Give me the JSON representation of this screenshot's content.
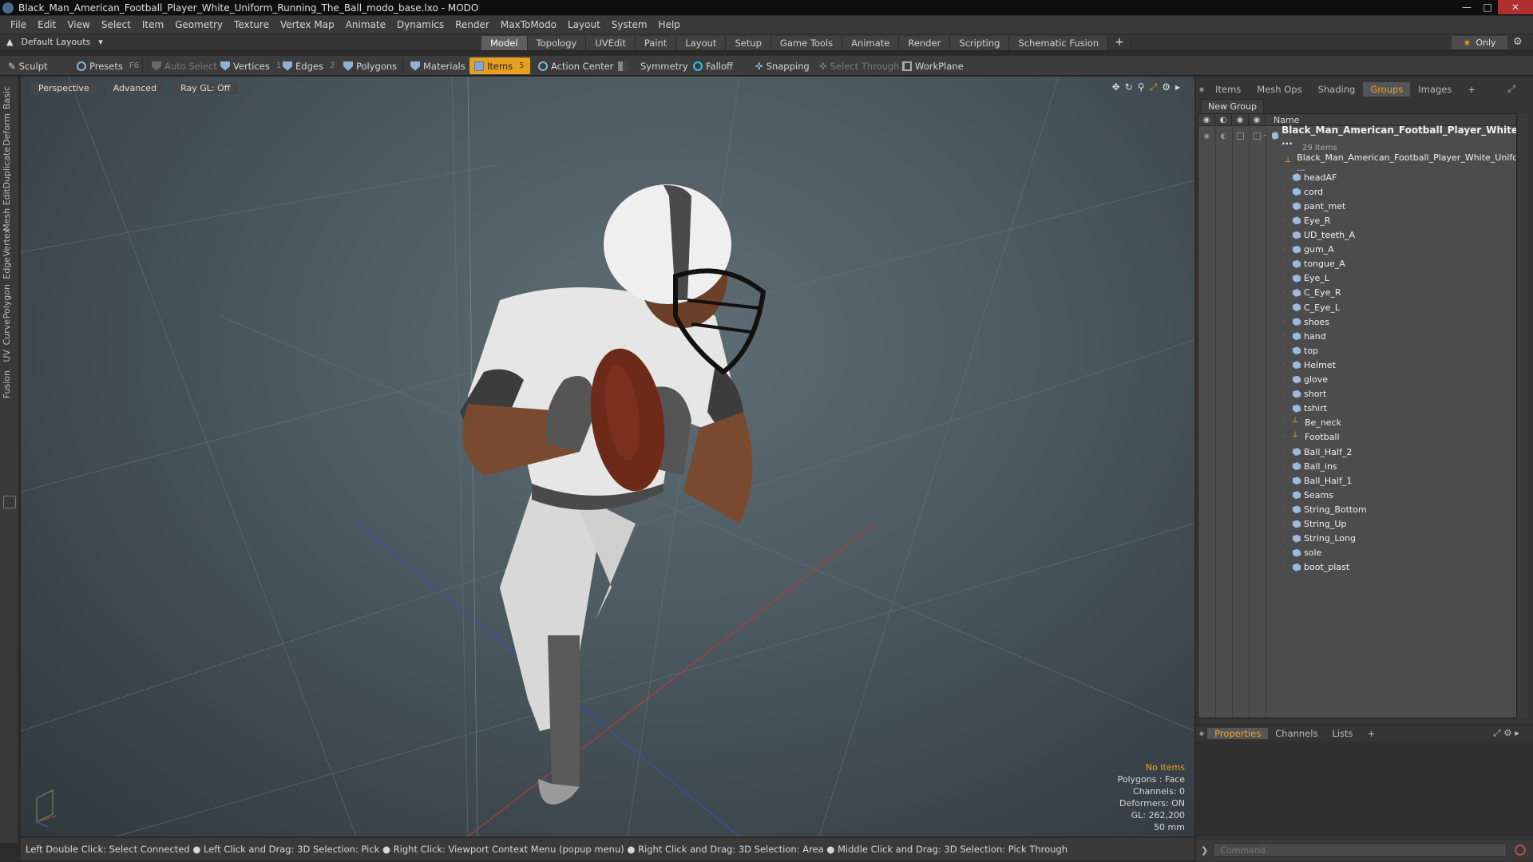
{
  "window": {
    "title": "Black_Man_American_Football_Player_White_Uniform_Running_The_Ball_modo_base.lxo - MODO"
  },
  "menu": [
    "File",
    "Edit",
    "View",
    "Select",
    "Item",
    "Geometry",
    "Texture",
    "Vertex Map",
    "Animate",
    "Dynamics",
    "Render",
    "MaxToModo",
    "Layout",
    "System",
    "Help"
  ],
  "layout_bar": {
    "layouts_label": "Default Layouts",
    "tabs": [
      "Model",
      "Topology",
      "UVEdit",
      "Paint",
      "Layout",
      "Setup",
      "Game Tools",
      "Animate",
      "Render",
      "Scripting",
      "Schematic Fusion"
    ],
    "active_tab": "Model",
    "only_label": "Only"
  },
  "toolbar": {
    "sculpt": "Sculpt",
    "presets": "Presets",
    "presets_shortcut": "F6",
    "auto_select": "Auto Select",
    "vertices": "Vertices",
    "vertices_count": "1",
    "edges": "Edges",
    "edges_count": "2",
    "polygons": "Polygons",
    "materials": "Materials",
    "items": "Items",
    "items_count": "5",
    "action_center": "Action Center",
    "symmetry": "Symmetry",
    "falloff": "Falloff",
    "snapping": "Snapping",
    "select_through": "Select Through",
    "workplane": "WorkPlane"
  },
  "left_tabs": [
    "Basic",
    "Deform",
    "Duplicate",
    "Mesh Edit",
    "Vertex",
    "Edge",
    "Polygon",
    "Curve",
    "UV",
    "Fusion"
  ],
  "viewport": {
    "view_mode": "Perspective",
    "advanced": "Advanced",
    "raygl": "Ray GL: Off",
    "stats": {
      "selection": "No Items",
      "polygons": "Polygons : Face",
      "channels": "Channels: 0",
      "deformers": "Deformers: ON",
      "gl": "GL: 262,200",
      "lens": "50 mm"
    }
  },
  "statusbar": {
    "hint": "Left Double Click: Select Connected ● Left Click and Drag: 3D Selection: Pick ● Right Click: Viewport Context Menu (popup menu) ● Right Click and Drag: 3D Selection: Area ● Middle Click and Drag: 3D Selection: Pick Through"
  },
  "right_panel": {
    "tabs": [
      "Items",
      "Mesh Ops",
      "Shading",
      "Groups",
      "Images"
    ],
    "active_tab": "Groups",
    "new_group": "New Group",
    "name_header": "Name",
    "root_group": "Black_Man_American_Football_Player_White ...",
    "root_count": "29 Items",
    "items": [
      {
        "name": "Black_Man_American_Football_Player_White_Unifo ...",
        "kind": "locator"
      },
      {
        "name": "headAF",
        "kind": "mesh"
      },
      {
        "name": "cord",
        "kind": "mesh"
      },
      {
        "name": "pant_met",
        "kind": "mesh"
      },
      {
        "name": "Eye_R",
        "kind": "mesh"
      },
      {
        "name": "UD_teeth_A",
        "kind": "mesh"
      },
      {
        "name": "gum_A",
        "kind": "mesh"
      },
      {
        "name": "tongue_A",
        "kind": "mesh"
      },
      {
        "name": "Eye_L",
        "kind": "mesh"
      },
      {
        "name": "C_Eye_R",
        "kind": "mesh"
      },
      {
        "name": "C_Eye_L",
        "kind": "mesh"
      },
      {
        "name": "shoes",
        "kind": "mesh"
      },
      {
        "name": "hand",
        "kind": "mesh"
      },
      {
        "name": "top",
        "kind": "mesh"
      },
      {
        "name": "Helmet",
        "kind": "mesh"
      },
      {
        "name": "glove",
        "kind": "mesh"
      },
      {
        "name": "short",
        "kind": "mesh"
      },
      {
        "name": "tshirt",
        "kind": "mesh"
      },
      {
        "name": "Be_neck",
        "kind": "locator"
      },
      {
        "name": "Football",
        "kind": "locator"
      },
      {
        "name": "Ball_Half_2",
        "kind": "mesh"
      },
      {
        "name": "Ball_ins",
        "kind": "mesh"
      },
      {
        "name": "Ball_Half_1",
        "kind": "mesh"
      },
      {
        "name": "Seams",
        "kind": "mesh"
      },
      {
        "name": "String_Bottom",
        "kind": "mesh"
      },
      {
        "name": "String_Up",
        "kind": "mesh"
      },
      {
        "name": "String_Long",
        "kind": "mesh"
      },
      {
        "name": "sole",
        "kind": "mesh"
      },
      {
        "name": "boot_plast",
        "kind": "mesh"
      }
    ],
    "bottom_tabs": [
      "Properties",
      "Channels",
      "Lists"
    ],
    "bottom_active": "Properties",
    "command_placeholder": "Command"
  },
  "colors": {
    "accent": "#e8a020",
    "panel": "#353535",
    "list_bg": "#4c4c4c"
  }
}
